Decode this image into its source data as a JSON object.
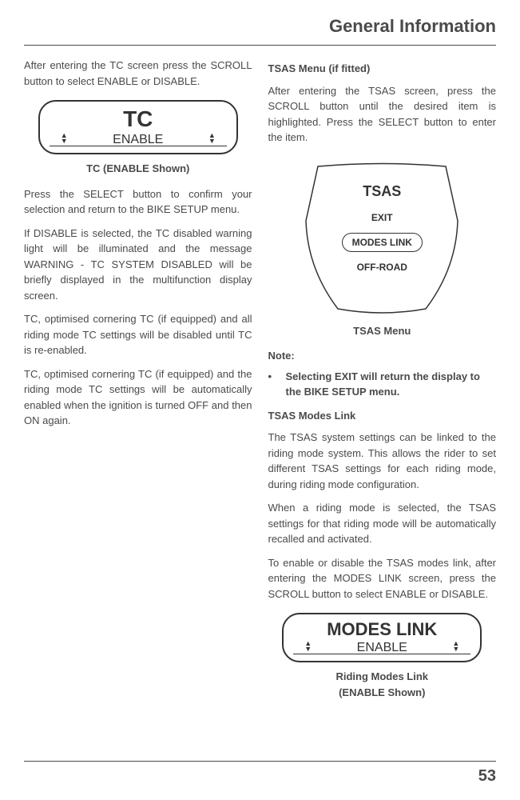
{
  "header": {
    "title": "General Information"
  },
  "pageNumber": "53",
  "left": {
    "intro": "After entering the TC screen press the SCROLL button to select ENABLE or DISABLE.",
    "display": {
      "big": "TC",
      "small": "ENABLE"
    },
    "caption": "TC (ENABLE Shown)",
    "p1": "Press the SELECT button to confirm your selection and return to the BIKE SETUP menu.",
    "p2": "If DISABLE is selected, the TC disabled warning light will be illuminated and the message WARNING - TC SYSTEM DISABLED will be briefly displayed in the multifunction display screen.",
    "p3": "TC, optimised cornering TC (if equipped) and all riding mode TC settings will be disabled until TC is re-enabled.",
    "p4": "TC, optimised cornering TC (if equipped) and the riding mode TC settings will be automatically enabled when the ignition is turned OFF and then ON again."
  },
  "right": {
    "heading1": "TSAS Menu (if fitted)",
    "p1": "After entering the TSAS screen, press the SCROLL button until the desired item is highlighted. Press the SELECT button to enter the item.",
    "tsas": {
      "title": "TSAS",
      "item1": "EXIT",
      "item2": "MODES LINK",
      "item3": "OFF-ROAD"
    },
    "caption1": "TSAS Menu",
    "noteLabel": "Note:",
    "noteBullet": "Selecting EXIT will return the display to the BIKE SETUP menu.",
    "heading2": "TSAS Modes Link",
    "p2": "The TSAS system settings can be linked to the riding mode system. This allows the rider to set different TSAS settings for each riding mode, during riding mode configuration.",
    "p3": "When a riding mode is selected, the TSAS settings for that riding mode will be automatically recalled and activated.",
    "p4": "To enable or disable the TSAS modes link, after entering the MODES LINK screen, press the SCROLL button to select ENABLE or DISABLE.",
    "display": {
      "big": "MODES LINK",
      "small": "ENABLE"
    },
    "caption2a": "Riding Modes Link",
    "caption2b": "(ENABLE Shown)"
  }
}
